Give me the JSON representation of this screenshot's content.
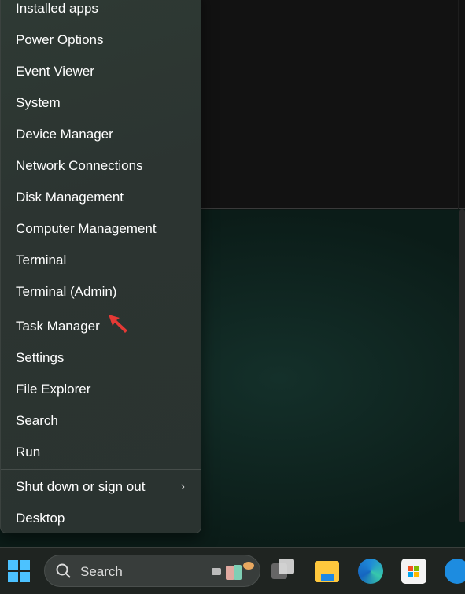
{
  "menu": {
    "items": [
      "Installed apps",
      "Power Options",
      "Event Viewer",
      "System",
      "Device Manager",
      "Network Connections",
      "Disk Management",
      "Computer Management",
      "Terminal",
      "Terminal (Admin)",
      "Task Manager",
      "Settings",
      "File Explorer",
      "Search",
      "Run",
      "Shut down or sign out",
      "Desktop"
    ]
  },
  "taskbar": {
    "search_label": "Search",
    "icons": [
      "start-icon",
      "search-icon",
      "task-view-icon",
      "file-explorer-icon",
      "edge-icon",
      "store-icon",
      "docker-icon"
    ]
  },
  "colors": {
    "accent": "#4cc2ff",
    "arrow": "#e53935"
  }
}
